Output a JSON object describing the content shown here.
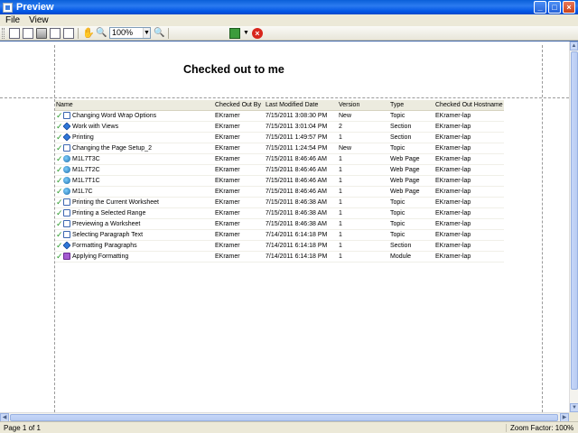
{
  "window": {
    "title": "Preview"
  },
  "menu": {
    "file": "File",
    "view": "View"
  },
  "toolbar": {
    "zoom": "100%"
  },
  "report": {
    "title": "Checked out to me",
    "columns": [
      "Name",
      "Checked Out By",
      "Last Modified Date",
      "Version",
      "Type",
      "Checked Out Hostname"
    ],
    "rows": [
      [
        "Changing Word Wrap Options",
        "EKramer",
        "7/15/2011 3:08:30 PM",
        "New",
        "Topic",
        "EKramer-lap"
      ],
      [
        "Work with Views",
        "EKramer",
        "7/15/2011 3:01:04 PM",
        "2",
        "Section",
        "EKramer-lap"
      ],
      [
        "Printing",
        "EKramer",
        "7/15/2011 1:49:57 PM",
        "1",
        "Section",
        "EKramer-lap"
      ],
      [
        "Changing the Page Setup_2",
        "EKramer",
        "7/15/2011 1:24:54 PM",
        "New",
        "Topic",
        "EKramer-lap"
      ],
      [
        "M1L7T3C",
        "EKramer",
        "7/15/2011 8:46:46 AM",
        "1",
        "Web Page",
        "EKramer-lap"
      ],
      [
        "M1L7T2C",
        "EKramer",
        "7/15/2011 8:46:46 AM",
        "1",
        "Web Page",
        "EKramer-lap"
      ],
      [
        "M1L7T1C",
        "EKramer",
        "7/15/2011 8:46:46 AM",
        "1",
        "Web Page",
        "EKramer-lap"
      ],
      [
        "M1L7C",
        "EKramer",
        "7/15/2011 8:46:46 AM",
        "1",
        "Web Page",
        "EKramer-lap"
      ],
      [
        "Printing the Current Worksheet",
        "EKramer",
        "7/15/2011 8:46:38 AM",
        "1",
        "Topic",
        "EKramer-lap"
      ],
      [
        "Printing a Selected Range",
        "EKramer",
        "7/15/2011 8:46:38 AM",
        "1",
        "Topic",
        "EKramer-lap"
      ],
      [
        "Previewing a Worksheet",
        "EKramer",
        "7/15/2011 8:46:38 AM",
        "1",
        "Topic",
        "EKramer-lap"
      ],
      [
        "Selecting Paragraph Text",
        "EKramer",
        "7/14/2011 6:14:18 PM",
        "1",
        "Topic",
        "EKramer-lap"
      ],
      [
        "Formatting Paragraphs",
        "EKramer",
        "7/14/2011 6:14:18 PM",
        "1",
        "Section",
        "EKramer-lap"
      ],
      [
        "Applying Formatting",
        "EKramer",
        "7/14/2011 6:14:18 PM",
        "1",
        "Module",
        "EKramer-lap"
      ]
    ]
  },
  "status": {
    "page": "Page 1 of 1",
    "zoom": "Zoom Factor: 100%"
  }
}
